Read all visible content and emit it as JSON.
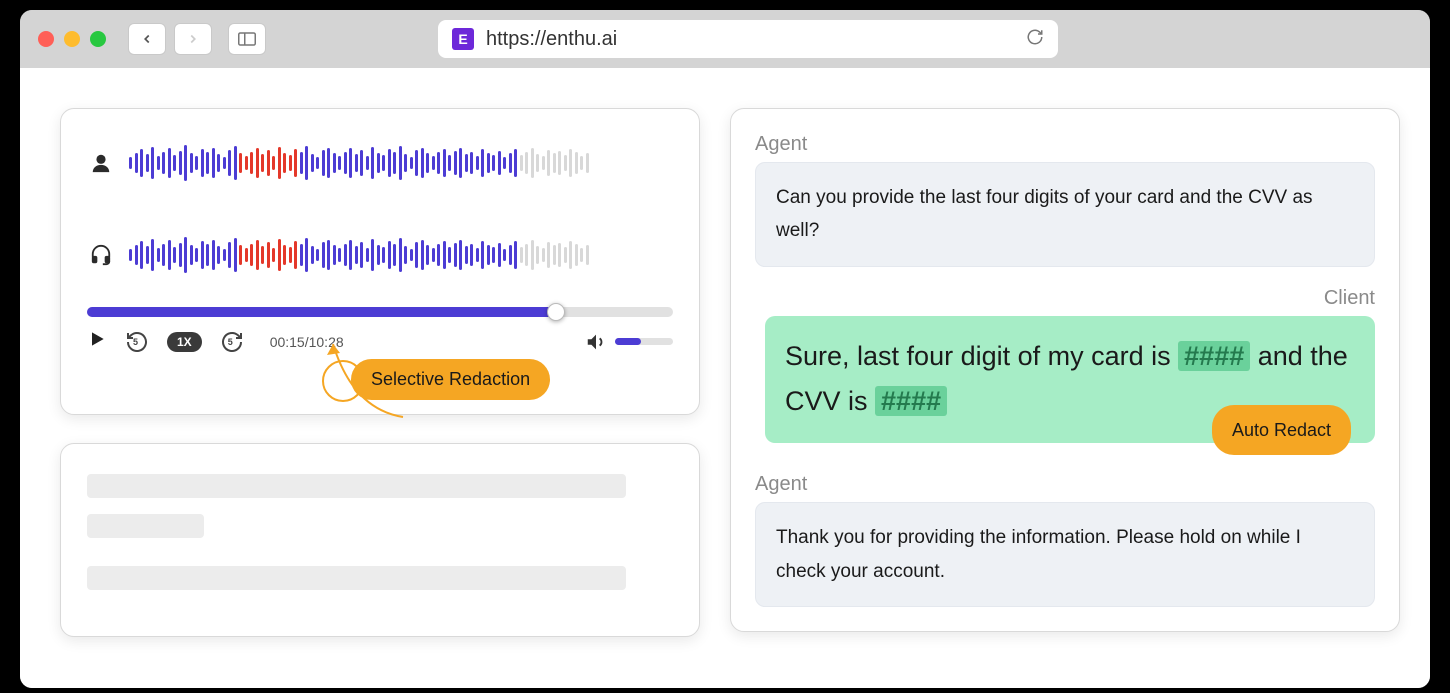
{
  "browser": {
    "url": "https://enthu.ai",
    "favicon_letter": "E"
  },
  "audio_player": {
    "time_display": "00:15/10:28",
    "speed_label": "1X",
    "selective_badge": "Selective Redaction",
    "waveform_colors": {
      "normal": "#4c3cd4",
      "redacted": "#e4382a",
      "future": "#d8d8d8"
    }
  },
  "transcript": {
    "agent_label": "Agent",
    "client_label": "Client",
    "messages": [
      {
        "speaker": "agent",
        "text": "Can you provide the last four digits of your card and the CVV as well?"
      },
      {
        "speaker": "client",
        "pre": "Sure, last four digit of my card is ",
        "r1": "####",
        "mid": " and the CVV is ",
        "r2": "####"
      },
      {
        "speaker": "agent",
        "text": "Thank you for providing the information. Please hold on while I check your account."
      }
    ],
    "auto_redact_badge": "Auto Redact"
  }
}
